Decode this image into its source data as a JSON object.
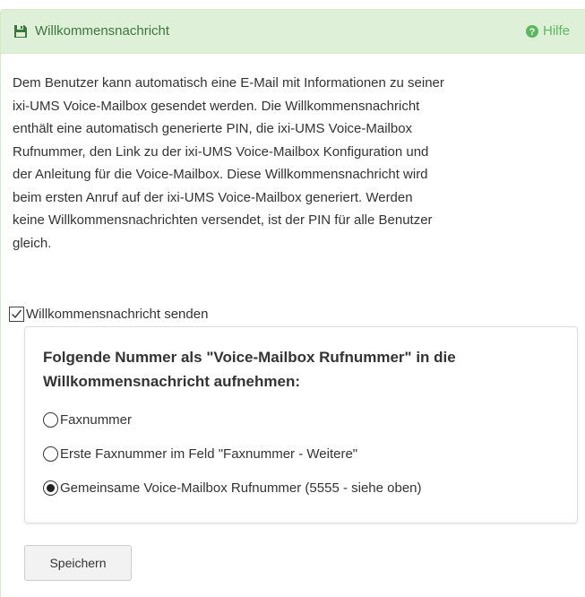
{
  "panel": {
    "title": "Willkommensnachricht",
    "title_icon": "floppy-disk-icon",
    "help_label": "Hilfe",
    "help_icon": "question-circle-icon",
    "heading_bg": "#dff0d8",
    "heading_text_color": "#3c763d",
    "help_color": "#5cb85c"
  },
  "description_lines": [
    "Dem Benutzer kann automatisch eine E-Mail mit Informationen zu seiner",
    "ixi-UMS Voice-Mailbox gesendet werden. Die Willkommensnachricht",
    "enthält eine automatisch generierte PIN, die ixi-UMS Voice-Mailbox",
    "Rufnummer, den Link zu der ixi-UMS Voice-Mailbox Konfiguration und",
    "der Anleitung für die Voice-Mailbox. Diese Willkommensnachricht wird",
    "beim ersten Anruf auf der ixi-UMS Voice-Mailbox generiert. Werden",
    "keine Willkommensnachrichten versendet, ist der PIN für alle Benutzer",
    "gleich."
  ],
  "send_checkbox": {
    "label": "Willkommensnachricht senden",
    "checked": true
  },
  "number_options": {
    "title_lines": [
      "Folgende Nummer als \"Voice-Mailbox Rufnummer\" in die",
      "Willkommensnachricht aufnehmen:"
    ],
    "options": [
      {
        "label": "Faxnummer",
        "selected": false
      },
      {
        "label": "Erste Faxnummer im Feld \"Faxnummer - Weitere\"",
        "selected": false
      },
      {
        "label": "Gemeinsame Voice-Mailbox Rufnummer (5555 - siehe oben)",
        "selected": true
      }
    ]
  },
  "save_button_label": "Speichern"
}
